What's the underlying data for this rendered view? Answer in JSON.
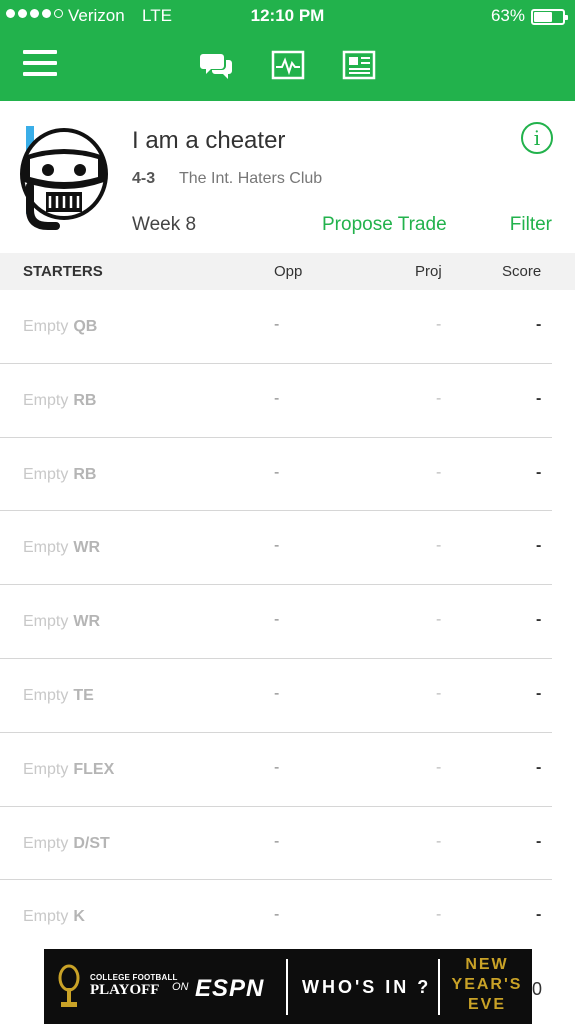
{
  "status_bar": {
    "carrier": "Verizon",
    "network": "LTE",
    "time": "12:10 PM",
    "battery_pct": "63%",
    "battery_level": 0.63
  },
  "nav": {
    "menu_icon": "hamburger-menu-icon",
    "icons": [
      "chat-bubbles-icon",
      "activity-chart-icon",
      "news-icon"
    ]
  },
  "team": {
    "name": "I am a cheater",
    "record": "4-3",
    "league": "The Int. Haters Club",
    "week": "Week 8",
    "propose_trade": "Propose Trade",
    "filter": "Filter",
    "info_symbol": "i",
    "avatar_icon": "snorkel-skull-avatar-icon"
  },
  "table": {
    "headers": {
      "starters": "STARTERS",
      "opp": "Opp",
      "proj": "Proj",
      "score": "Score"
    },
    "rows": [
      {
        "label": "Empty",
        "pos": "QB",
        "opp": "-",
        "proj": "-",
        "score": "-"
      },
      {
        "label": "Empty",
        "pos": "RB",
        "opp": "-",
        "proj": "-",
        "score": "-"
      },
      {
        "label": "Empty",
        "pos": "RB",
        "opp": "-",
        "proj": "-",
        "score": "-"
      },
      {
        "label": "Empty",
        "pos": "WR",
        "opp": "-",
        "proj": "-",
        "score": "-"
      },
      {
        "label": "Empty",
        "pos": "WR",
        "opp": "-",
        "proj": "-",
        "score": "-"
      },
      {
        "label": "Empty",
        "pos": "TE",
        "opp": "-",
        "proj": "-",
        "score": "-"
      },
      {
        "label": "Empty",
        "pos": "FLEX",
        "opp": "-",
        "proj": "-",
        "score": "-"
      },
      {
        "label": "Empty",
        "pos": "D/ST",
        "opp": "-",
        "proj": "-",
        "score": "-"
      },
      {
        "label": "Empty",
        "pos": "K",
        "opp": "-",
        "proj": "-",
        "score": "-"
      }
    ]
  },
  "ad": {
    "cfp_small": "COLLEGE FOOTBALL",
    "cfp_big": "PLAYOFF",
    "on": "ON",
    "network": "ESPN",
    "whos_in": "WHO'S IN ?",
    "nye_line1": "NEW",
    "nye_line2": "YEAR'S",
    "nye_line3": "EVE",
    "tail": "0"
  },
  "colors": {
    "brand_green": "#22b24c",
    "ad_gold": "#c9a227"
  }
}
